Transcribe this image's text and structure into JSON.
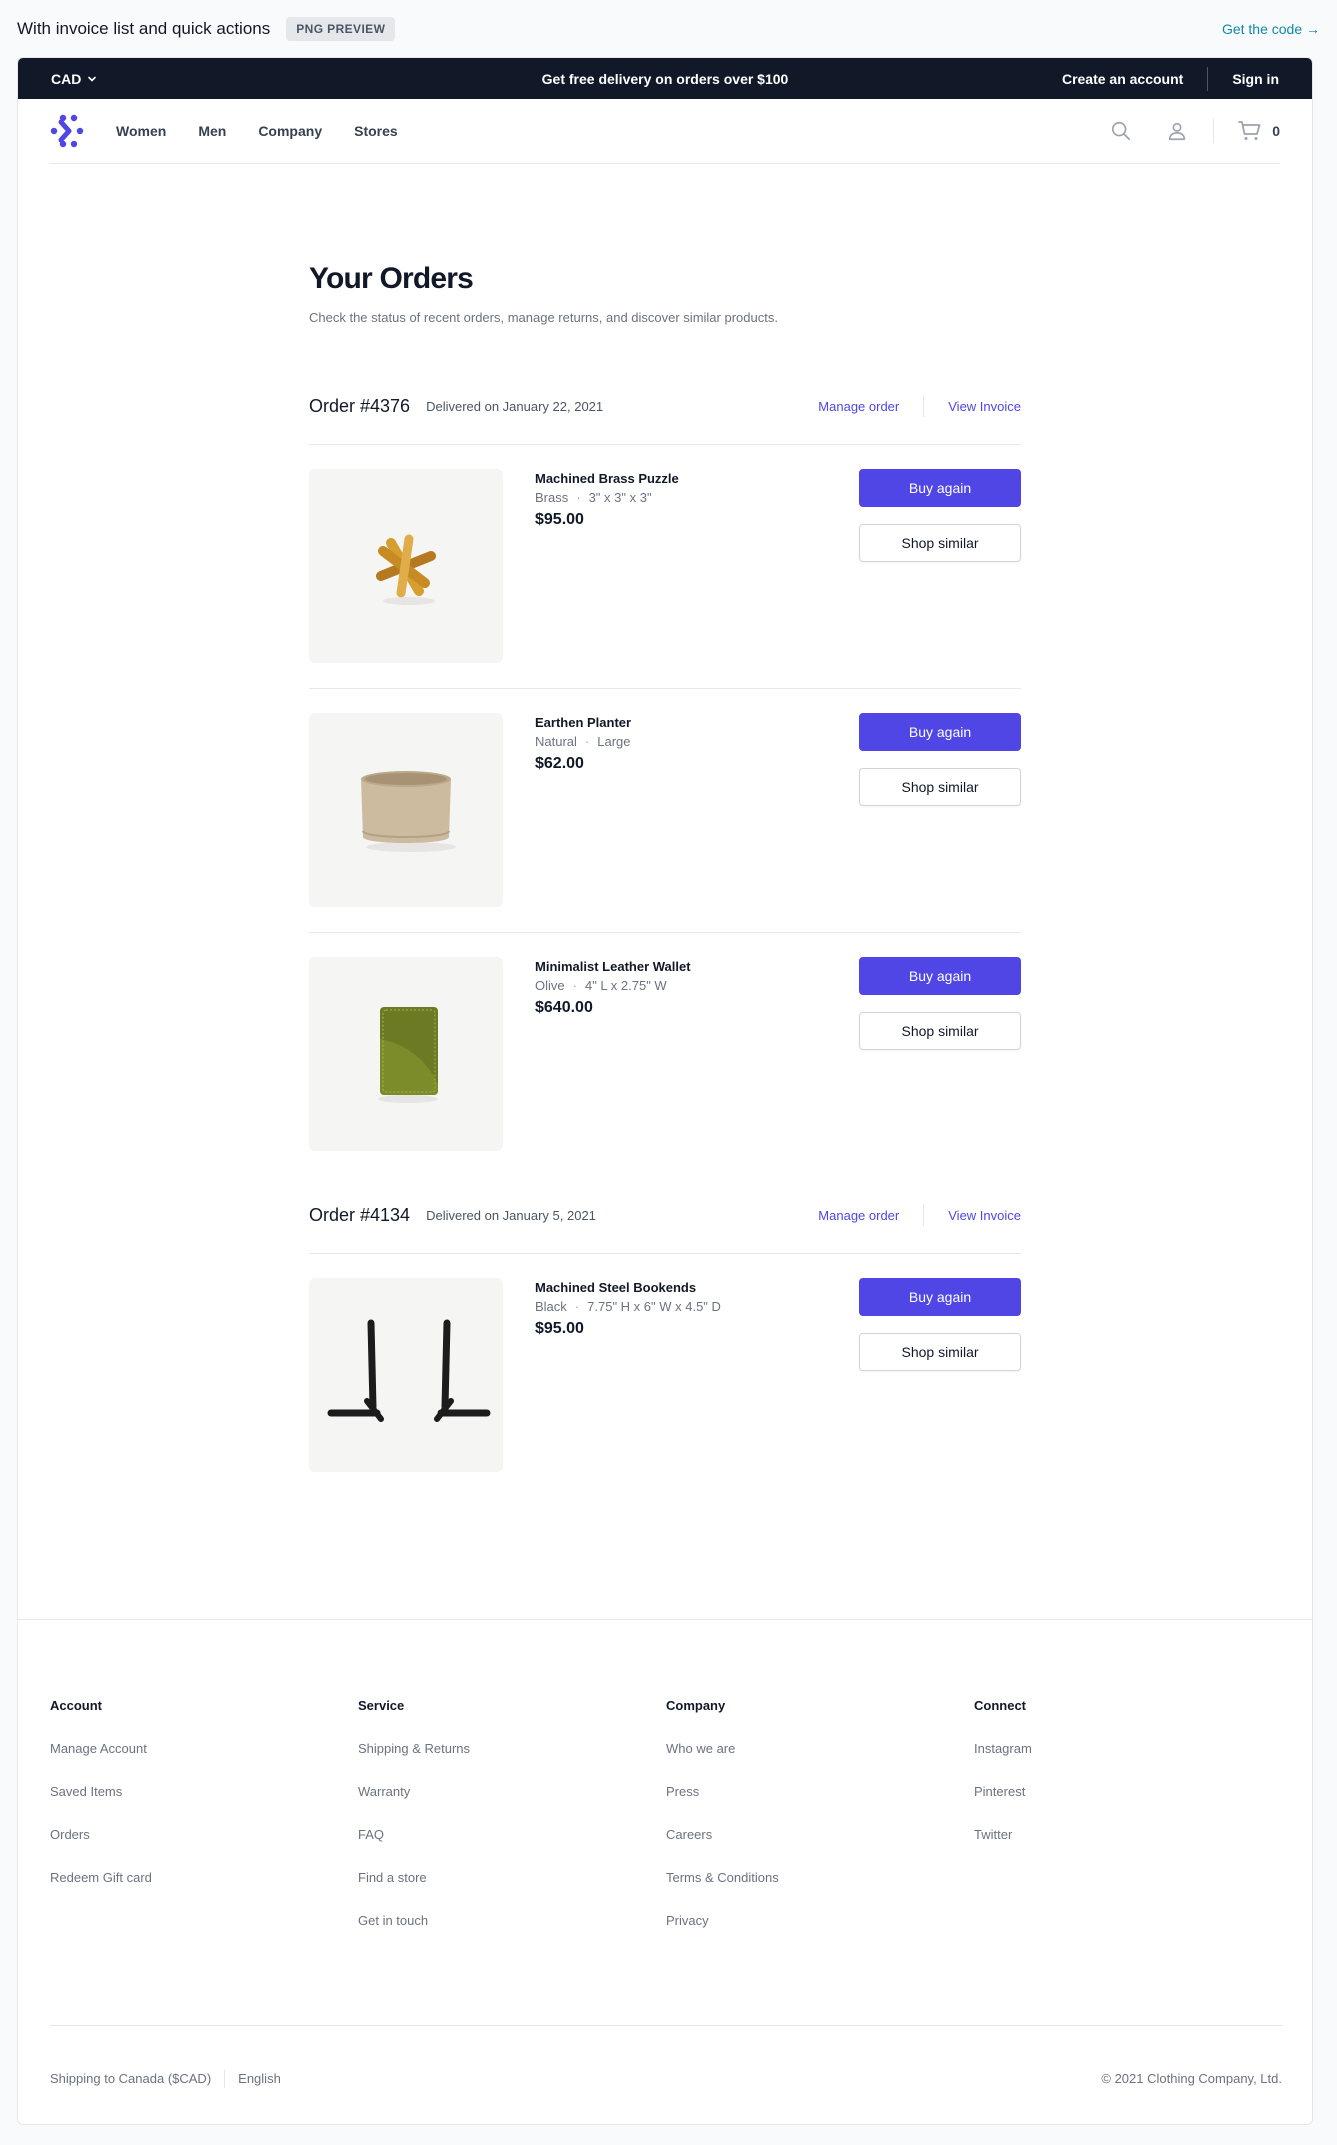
{
  "preview": {
    "title": "With invoice list and quick actions",
    "badge": "PNG PREVIEW",
    "get_code": "Get the code →"
  },
  "promo": {
    "currency": "CAD",
    "message": "Get free delivery on orders over $100",
    "create_account": "Create an account",
    "sign_in": "Sign in"
  },
  "nav": {
    "links": [
      "Women",
      "Men",
      "Company",
      "Stores"
    ],
    "cart_count": "0"
  },
  "page": {
    "title": "Your Orders",
    "subtitle": "Check the status of recent orders, manage returns, and discover similar products."
  },
  "orders": [
    {
      "number": "Order #4376",
      "date": "Delivered on January 22, 2021",
      "manage": "Manage order",
      "invoice": "View Invoice",
      "items": [
        {
          "name": "Machined Brass Puzzle",
          "meta1": "Brass",
          "meta2": "3\" x 3\" x 3\"",
          "price": "$95.00",
          "buy": "Buy again",
          "shop": "Shop similar"
        },
        {
          "name": "Earthen Planter",
          "meta1": "Natural",
          "meta2": "Large",
          "price": "$62.00",
          "buy": "Buy again",
          "shop": "Shop similar"
        },
        {
          "name": "Minimalist Leather Wallet",
          "meta1": "Olive",
          "meta2": "4\" L x 2.75\" W",
          "price": "$640.00",
          "buy": "Buy again",
          "shop": "Shop similar"
        }
      ]
    },
    {
      "number": "Order #4134",
      "date": "Delivered on January 5, 2021",
      "manage": "Manage order",
      "invoice": "View Invoice",
      "items": [
        {
          "name": "Machined Steel Bookends",
          "meta1": "Black",
          "meta2": "7.75\" H x 6\" W x 4.5\" D",
          "price": "$95.00",
          "buy": "Buy again",
          "shop": "Shop similar"
        }
      ]
    }
  ],
  "footer": {
    "columns": [
      {
        "title": "Account",
        "links": [
          "Manage Account",
          "Saved Items",
          "Orders",
          "Redeem Gift card"
        ]
      },
      {
        "title": "Service",
        "links": [
          "Shipping & Returns",
          "Warranty",
          "FAQ",
          "Find a store",
          "Get in touch"
        ]
      },
      {
        "title": "Company",
        "links": [
          "Who we are",
          "Press",
          "Careers",
          "Terms & Conditions",
          "Privacy"
        ]
      },
      {
        "title": "Connect",
        "links": [
          "Instagram",
          "Pinterest",
          "Twitter"
        ]
      }
    ],
    "shipping": "Shipping to Canada ($CAD)",
    "language": "English",
    "copyright": "© 2021 Clothing Company, Ltd."
  },
  "colors": {
    "accent": "#4f46e5",
    "promo_bg": "#111827",
    "link_teal": "#0e8ba5"
  }
}
